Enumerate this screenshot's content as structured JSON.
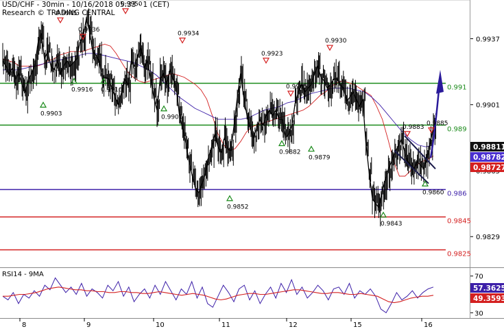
{
  "header": {
    "title": "USD/CHF - 30min - 10/16/2018 05:33 · 1 (CET)",
    "credit": "Research © TRADING CENTRAL"
  },
  "chart_data": [
    {
      "type": "line",
      "title": "USD/CHF - 30min",
      "price_axis": {
        "ylim": [
          0.9813,
          0.9957
        ],
        "ticks": [
          "0.9937",
          "0.9901",
          "0.9865",
          "0.9829"
        ]
      },
      "date_axis": {
        "ticks": [
          "8",
          "9",
          "10",
          "11",
          "12",
          "15",
          "16"
        ]
      },
      "horizontal_levels": [
        {
          "label": "0.991",
          "value": 0.9913,
          "color": "#1a8a1a"
        },
        {
          "label": "0.989",
          "value": 0.989,
          "color": "#1a8a1a"
        },
        {
          "label": "0.986",
          "value": 0.9855,
          "color": "#3c1fa8"
        },
        {
          "label": "0.9845",
          "value": 0.984,
          "color": "#d42020"
        },
        {
          "label": "0.9825",
          "value": 0.9822,
          "color": "#d42020"
        }
      ],
      "price_boxes": [
        {
          "label": "0.98811",
          "value": 0.98811,
          "color": "#111111"
        },
        {
          "label": "0.98782",
          "value": 0.98782,
          "color": "#4a2fd0"
        },
        {
          "label": "0.98727",
          "value": 0.98727,
          "color": "#d42020"
        }
      ],
      "annotations": [
        {
          "type": "high",
          "label": "0.9945",
          "color": "#d42020"
        },
        {
          "type": "high",
          "label": "0.9936",
          "color": "#d42020"
        },
        {
          "type": "high",
          "label": "0.9950",
          "color": "#d42020"
        },
        {
          "type": "high",
          "label": "0.9934",
          "color": "#d42020"
        },
        {
          "type": "high",
          "label": "0.9923",
          "color": "#d42020"
        },
        {
          "type": "high",
          "label": "0.9905",
          "color": "#d42020"
        },
        {
          "type": "high",
          "label": "0.9930",
          "color": "#d42020"
        },
        {
          "type": "high",
          "label": "0.9883",
          "color": "#d42020"
        },
        {
          "type": "high",
          "label": "0.9885",
          "color": "#d42020"
        },
        {
          "type": "low",
          "label": "0.9903",
          "color": "#1a8a1a"
        },
        {
          "type": "low",
          "label": "0.9916",
          "color": "#1a8a1a"
        },
        {
          "type": "low",
          "label": "0.9916",
          "color": "#1a8a1a"
        },
        {
          "type": "low",
          "label": "0.9901",
          "color": "#1a8a1a"
        },
        {
          "type": "low",
          "label": "0.9852",
          "color": "#1a8a1a"
        },
        {
          "type": "low",
          "label": "0.9882",
          "color": "#1a8a1a"
        },
        {
          "type": "low",
          "label": "0.9879",
          "color": "#1a8a1a"
        },
        {
          "type": "low",
          "label": "0.9843",
          "color": "#1a8a1a"
        },
        {
          "type": "low",
          "label": "0.9860",
          "color": "#1a8a1a"
        }
      ],
      "series": [
        {
          "role": "price",
          "color": "#000000",
          "values": [
            0.9925,
            0.9922,
            0.9918,
            0.9921,
            0.9915,
            0.9918,
            0.9912,
            0.9908,
            0.9915,
            0.9918,
            0.9923,
            0.9935,
            0.994,
            0.9926,
            0.993,
            0.9922,
            0.992,
            0.9925,
            0.9918,
            0.9922,
            0.9925,
            0.9922,
            0.9924,
            0.9926,
            0.9935,
            0.9938,
            0.9948,
            0.9941,
            0.993,
            0.9928,
            0.9925,
            0.9915,
            0.9916,
            0.9915,
            0.991,
            0.9905,
            0.9901,
            0.9908,
            0.9915,
            0.9912,
            0.9925,
            0.9922,
            0.9928,
            0.9932,
            0.9921,
            0.9925,
            0.9915,
            0.9905,
            0.9898,
            0.9915,
            0.9918,
            0.9912,
            0.992,
            0.9915,
            0.991,
            0.9895,
            0.9888,
            0.988,
            0.987,
            0.9862,
            0.9855,
            0.9853,
            0.9858,
            0.9863,
            0.9872,
            0.9878,
            0.9885,
            0.9878,
            0.9875,
            0.9883,
            0.9877,
            0.9876,
            0.989,
            0.9905,
            0.9918,
            0.9905,
            0.9895,
            0.9888,
            0.9883,
            0.9888,
            0.9893,
            0.989,
            0.9895,
            0.9898,
            0.9895,
            0.9898,
            0.9893,
            0.9893,
            0.9883,
            0.9885,
            0.989,
            0.9902,
            0.9908,
            0.9912,
            0.9908,
            0.991,
            0.9912,
            0.9918,
            0.9922,
            0.9916,
            0.9914,
            0.991,
            0.9912,
            0.9915,
            0.9915,
            0.9912,
            0.991,
            0.9903,
            0.9905,
            0.9908,
            0.9904,
            0.99,
            0.9904,
            0.988,
            0.9864,
            0.985,
            0.9847,
            0.9845,
            0.9853,
            0.986,
            0.9866,
            0.987,
            0.9875,
            0.9878,
            0.9882,
            0.9876,
            0.987,
            0.9868,
            0.9866,
            0.987,
            0.9868,
            0.9866,
            0.9872,
            0.988,
            0.9889
          ]
        },
        {
          "role": "moving-average-fast",
          "color": "#d42020",
          "values": [
            0.9926,
            0.9925,
            0.9924,
            0.9922,
            0.9922,
            0.9922,
            0.9922,
            0.9923,
            0.9925,
            0.9926,
            0.9928,
            0.9929,
            0.993,
            0.993,
            0.993,
            0.9931,
            0.9932,
            0.9933,
            0.9934,
            0.9933,
            0.9929,
            0.9924,
            0.9919,
            0.9916,
            0.9914,
            0.9913,
            0.9914,
            0.9915,
            0.9916,
            0.9917,
            0.9918,
            0.9917,
            0.9916,
            0.9914,
            0.9912,
            0.9909,
            0.9904,
            0.9895,
            0.9885,
            0.9879,
            0.9876,
            0.9877,
            0.9881,
            0.9886,
            0.9889,
            0.989,
            0.9891,
            0.9892,
            0.9893,
            0.9894,
            0.9895,
            0.9896,
            0.9897,
            0.9898,
            0.99,
            0.9903,
            0.9906,
            0.9908,
            0.9911,
            0.9913,
            0.9914,
            0.9913,
            0.9912,
            0.991,
            0.9908,
            0.9906,
            0.99,
            0.9893,
            0.9882,
            0.987,
            0.9862,
            0.9862,
            0.9865,
            0.9868,
            0.987,
            0.9871,
            0.9873
          ]
        },
        {
          "role": "moving-average-slow",
          "color": "#3c1fa8",
          "values": [
            0.992,
            0.992,
            0.992,
            0.9921,
            0.9922,
            0.9923,
            0.9924,
            0.9925,
            0.9926,
            0.9927,
            0.9928,
            0.9929,
            0.9929,
            0.9928,
            0.9927,
            0.9926,
            0.9925,
            0.9924,
            0.9922,
            0.992,
            0.9917,
            0.9913,
            0.9909,
            0.9905,
            0.9902,
            0.9899,
            0.9897,
            0.9895,
            0.9893,
            0.9893,
            0.9893,
            0.9893,
            0.9894,
            0.9896,
            0.9898,
            0.9899,
            0.99,
            0.9902,
            0.9903,
            0.9905,
            0.9907,
            0.9908,
            0.9909,
            0.991,
            0.991,
            0.991,
            0.9909,
            0.9908,
            0.9905,
            0.9901,
            0.9896,
            0.9891,
            0.9886,
            0.9882,
            0.9879,
            0.9878,
            0.9879
          ]
        }
      ]
    },
    {
      "type": "line",
      "title": "RSI14 - 9MA",
      "ylim": [
        25,
        78
      ],
      "ticks": [
        "70",
        "30"
      ],
      "value_boxes": [
        {
          "label": "57.3625",
          "value": 57.3625,
          "color": "#3c1fa8"
        },
        {
          "label": "49.3593",
          "value": 49.3593,
          "color": "#d42020"
        }
      ],
      "series": [
        {
          "role": "rsi",
          "color": "#3c1fa8",
          "values": [
            48,
            44,
            52,
            40,
            50,
            46,
            54,
            48,
            60,
            55,
            68,
            60,
            52,
            58,
            50,
            62,
            48,
            56,
            52,
            46,
            60,
            54,
            64,
            48,
            58,
            42,
            50,
            56,
            46,
            60,
            50,
            64,
            54,
            44,
            56,
            50,
            64,
            46,
            58,
            40,
            36,
            48,
            60,
            52,
            42,
            56,
            60,
            44,
            54,
            40,
            50,
            58,
            46,
            62,
            52,
            66,
            50,
            58,
            46,
            52,
            60,
            54,
            44,
            56,
            58,
            50,
            62,
            46,
            54,
            50,
            56,
            48,
            34,
            30,
            40,
            52,
            44,
            48,
            54,
            46,
            52,
            56,
            58
          ]
        },
        {
          "role": "rsi-ma",
          "color": "#d42020",
          "values": [
            48,
            48,
            49,
            50,
            50,
            51,
            52,
            54,
            56,
            57,
            58,
            57,
            56,
            55,
            55,
            54,
            54,
            53,
            53,
            52,
            52,
            53,
            53,
            52,
            52,
            51,
            51,
            52,
            53,
            52,
            51,
            50,
            49,
            50,
            51,
            50,
            49,
            47,
            45,
            44,
            45,
            47,
            49,
            50,
            51,
            51,
            50,
            50,
            51,
            52,
            53,
            54,
            55,
            55,
            54,
            53,
            52,
            51,
            51,
            52,
            52,
            51,
            50,
            50,
            51,
            50,
            49,
            48,
            45,
            42,
            41,
            42,
            44,
            46,
            47,
            48,
            48,
            49
          ]
        }
      ]
    }
  ]
}
